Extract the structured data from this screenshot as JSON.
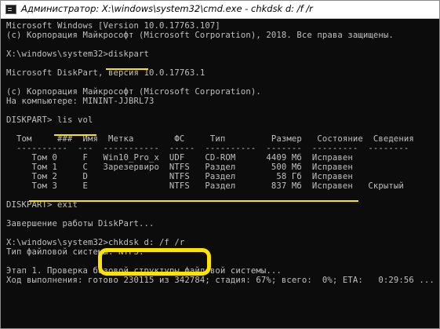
{
  "window": {
    "title": "Администратор: X:\\windows\\system32\\cmd.exe - chkdsk  d: /f /r",
    "icon": "cmd-icon"
  },
  "console": {
    "lines": [
      "Microsoft Windows [Version 10.0.17763.107]",
      "(c) Корпорация Майкрософт (Microsoft Corporation), 2018. Все права защищены.",
      "",
      "X:\\windows\\system32>diskpart",
      "",
      "Microsoft DiskPart, версия 10.0.17763.1",
      "",
      "(c) Корпорация Майкрософт (Microsoft Corporation).",
      "На компьютере: MININT-JJBRL73",
      "",
      "DISKPART> lis vol",
      "",
      "  Том     ###  Имя  Метка        ФС     Тип         Размер   Состояние  Сведения",
      "  ----------  ---  -----------  -----  ----------  -------  ---------  --------",
      "     Том 0     F   Win10_Pro_x  UDF    CD-ROM      4409 Мб  Исправен",
      "     Том 1     C   Зарезервиро  NTFS   Раздел       500 Мб  Исправен",
      "     Том 2     D                NTFS   Раздел        58 Гб  Исправен",
      "     Том 3     E                NTFS   Раздел       837 Мб  Исправен   Скрытый",
      "",
      "DISKPART> exit",
      "",
      "Завершение работы DiskPart...",
      "",
      "X:\\windows\\system32>chkdsk d: /f /r",
      "Тип файловой системы: NTFS.",
      "",
      "Этап 1. Проверка базовой структуры файловой системы...",
      "Ход выполнения: готово 230115 из 342784; стадия: 67%; всего:  0%; ETA:   0:29:56 ..."
    ]
  },
  "highlight": {
    "command": "chkdsk d: /f /r"
  },
  "colors": {
    "console_bg": "#0c0c0c",
    "console_text": "#c0c0c0",
    "annotation": "#ffe400"
  }
}
